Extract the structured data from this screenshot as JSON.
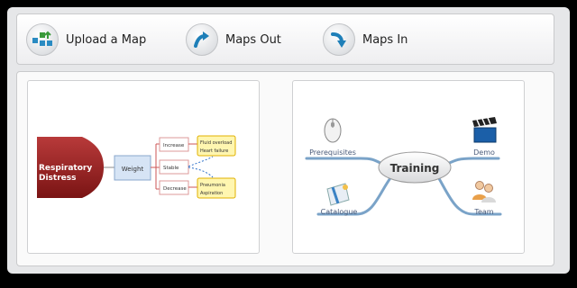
{
  "toolbar": {
    "upload": {
      "label": "Upload a Map",
      "icon": "upload-map-icon"
    },
    "maps_out": {
      "label": "Maps Out",
      "icon": "arrow-up-icon"
    },
    "maps_in": {
      "label": "Maps In",
      "icon": "arrow-down-icon"
    }
  },
  "maps": [
    {
      "root": "Respiratory Distress",
      "root_line1": "Respiratory",
      "root_line2": "Distress",
      "node": "Weight",
      "branches": [
        "Increase",
        "Stable",
        "Decrease"
      ],
      "outcomes_increase": [
        "Fluid overload",
        "Heart failure"
      ],
      "outcomes_decrease": [
        "Pneumonia",
        "Aspiration"
      ]
    },
    {
      "center": "Training",
      "branches": [
        "Prerequisites",
        "Demo",
        "Catalogue",
        "Team"
      ]
    }
  ],
  "colors": {
    "root_fill": "#8b1a1a",
    "node_fill": "#d6e4f5",
    "outcome_fill": "#fff6b0",
    "outcome_border": "#e0b000",
    "accent_arrow": "#2b8bc9"
  }
}
